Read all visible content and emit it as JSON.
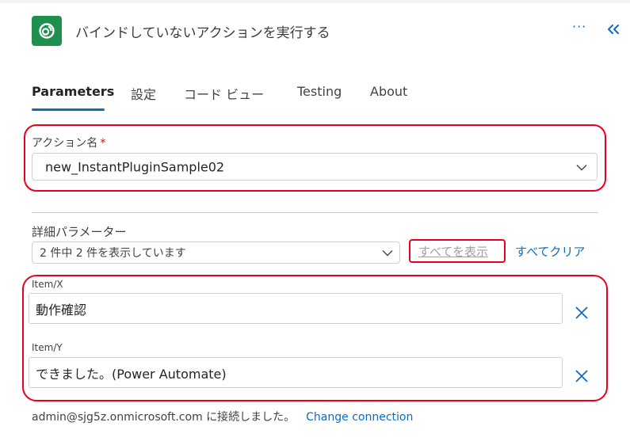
{
  "header": {
    "title": "バインドしていないアクションを実行する",
    "more_label": "···",
    "colors": {
      "logo_bg": "#1f8f4e",
      "accent": "#0f6cbd",
      "highlight": "#e8001c"
    }
  },
  "tabs": [
    {
      "label": "Parameters",
      "active": true
    },
    {
      "label": "設定"
    },
    {
      "label": "コード ビュー"
    },
    {
      "label": "Testing"
    },
    {
      "label": "About"
    }
  ],
  "action": {
    "label": "アクション名",
    "required_mark": "*",
    "value": "new_InstantPluginSample02"
  },
  "advanced": {
    "label": "詳細パラメーター",
    "selected_text": "2 件中 2 件を表示しています",
    "show_all_label": "すべてを表示",
    "clear_all_label": "すべてクリア"
  },
  "params": [
    {
      "label": "Item/X",
      "value": "動作確認"
    },
    {
      "label": "Item/Y",
      "value": "できました。(Power Automate)"
    }
  ],
  "footer": {
    "text": "admin@sjg5z.onmicrosoft.com に接続しました。",
    "link_label": "Change connection"
  }
}
